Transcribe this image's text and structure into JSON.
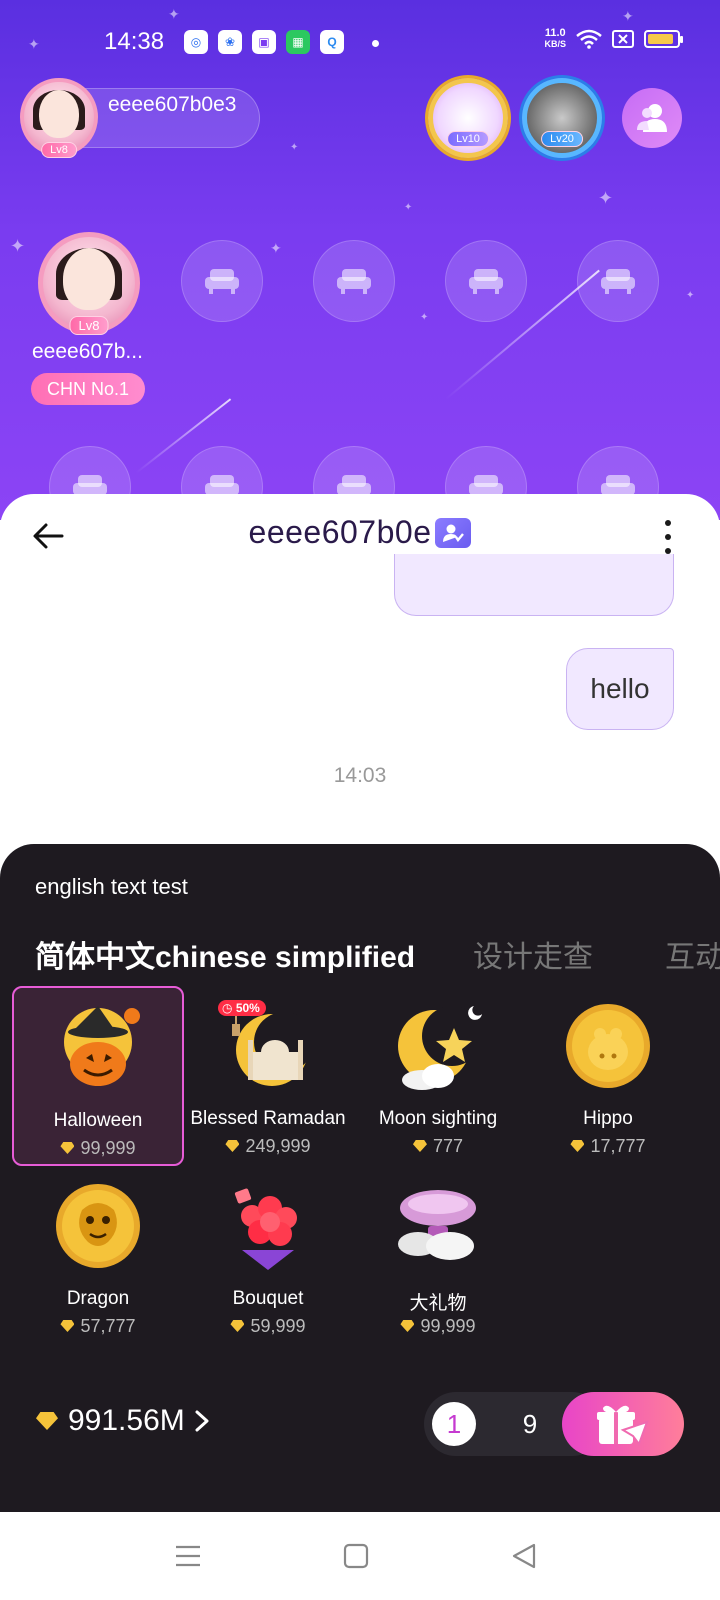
{
  "status_bar": {
    "time": "14:38",
    "net_speed_value": "11.0",
    "net_speed_unit": "KB/S",
    "battery_level": 0.9
  },
  "room": {
    "owner": {
      "name": "eeee607b0e3",
      "level": "Lv8"
    },
    "top_badges": [
      {
        "level": "Lv10",
        "name": "medal-badge"
      },
      {
        "level": "Lv20",
        "name": "medal-badge"
      }
    ],
    "host_seat": {
      "name": "eeee607b...",
      "level": "Lv8",
      "tag": "CHN No.1"
    },
    "empty_seats": 9
  },
  "chat": {
    "title": "eeee607b0e",
    "message": "hello",
    "timestamp": "14:03"
  },
  "gift_panel": {
    "note": "english text test",
    "tabs": [
      "简体中文chinese simplified",
      "设计走查",
      "互动"
    ],
    "active_tab": 0,
    "gifts": [
      {
        "name": "Halloween",
        "price": "99,999",
        "selected": true
      },
      {
        "name": "Blessed Ramadan",
        "price": "249,999",
        "discount": "50%"
      },
      {
        "name": "Moon sighting",
        "price": "777"
      },
      {
        "name": "Hippo",
        "price": "17,777"
      },
      {
        "name": "Dragon",
        "price": "57,777"
      },
      {
        "name": "Bouquet",
        "price": "59,999"
      },
      {
        "name": "大礼物",
        "price": "99,999"
      }
    ],
    "balance": "991.56M",
    "quantity_selected": "1",
    "quantity_other": "9"
  },
  "colors": {
    "room_bg": "#6a36ea",
    "accent_pink": "#e75cd7",
    "panel_bg": "#1e1a20",
    "bubble_bg": "#f1e8ff"
  }
}
